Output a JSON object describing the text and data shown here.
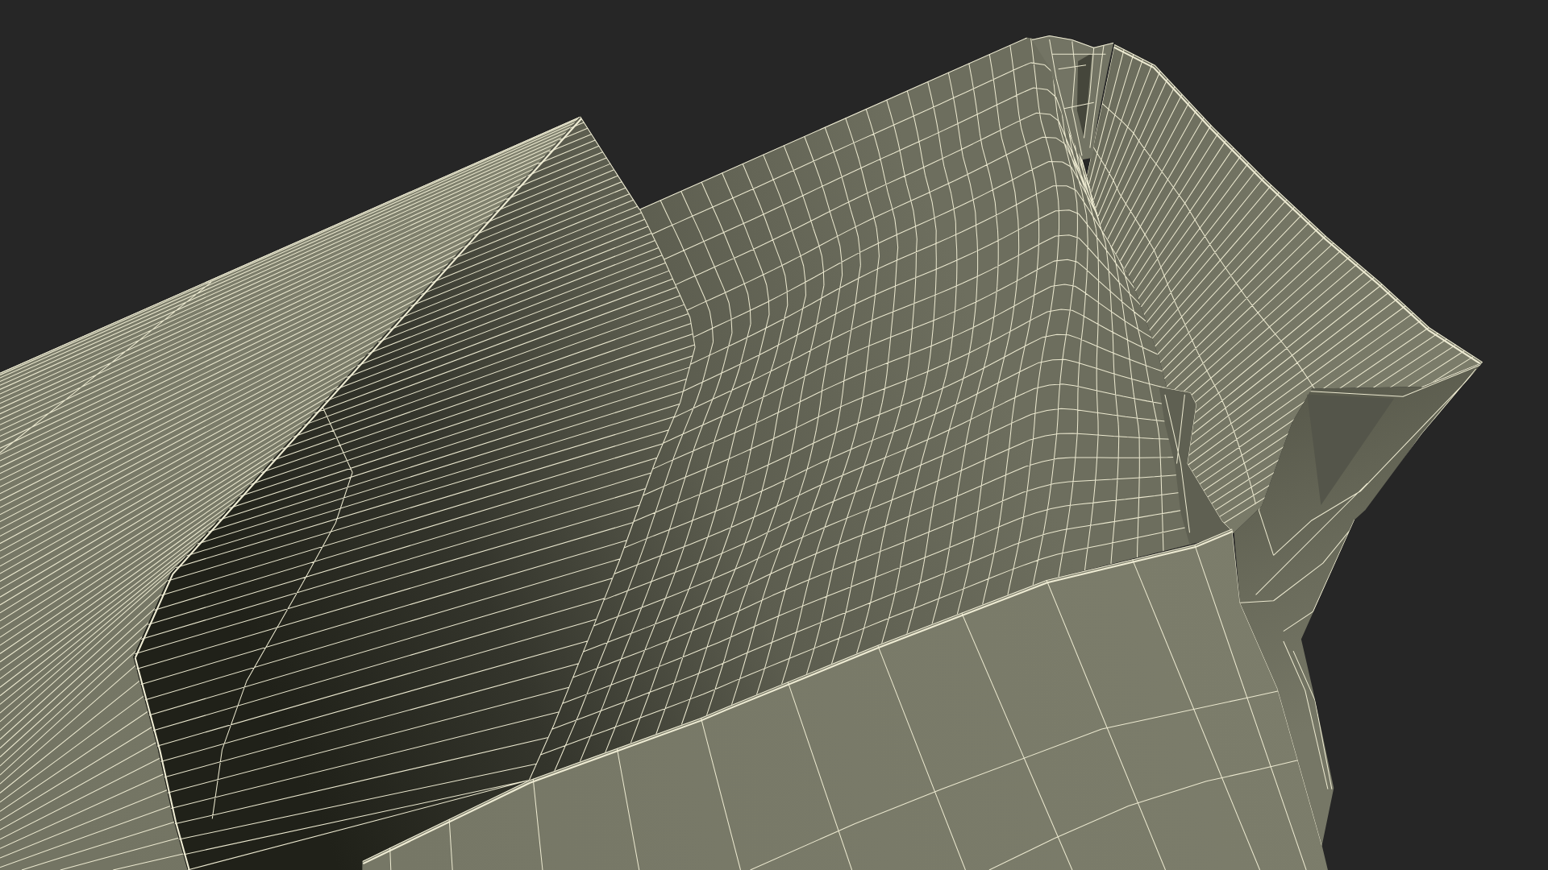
{
  "render": {
    "wireframe": true
  }
}
